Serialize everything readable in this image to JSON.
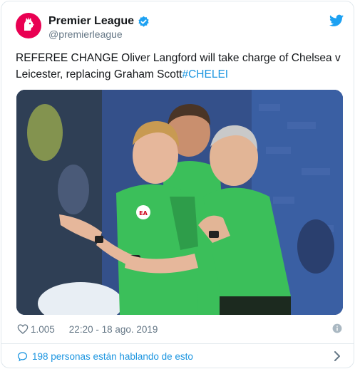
{
  "tweet": {
    "author_name": "Premier League",
    "author_handle": "@premierleague",
    "text_main": "REFEREE CHANGE Oliver Langford will take charge of Chelsea v Leicester, replacing Graham Scott",
    "hashtag": "#CHELEI",
    "likes": "1.005",
    "timestamp": "22:20 - 18 ago. 2019",
    "conversation": "198 personas están hablando de esto",
    "photo_badge": "EA"
  },
  "icons": {
    "avatar": "premier-league-lion-logo",
    "verified": "verified-badge-icon",
    "brand": "twitter-bird-icon",
    "like": "heart-icon",
    "info": "info-icon",
    "reply": "speech-bubble-icon",
    "more": "chevron-right-icon"
  },
  "colors": {
    "brand_blue": "#1da1f2",
    "link_blue": "#1b95e0",
    "avatar_bg": "#e90052",
    "muted_text": "#657786",
    "referee_kit": "#3bbf5a"
  }
}
